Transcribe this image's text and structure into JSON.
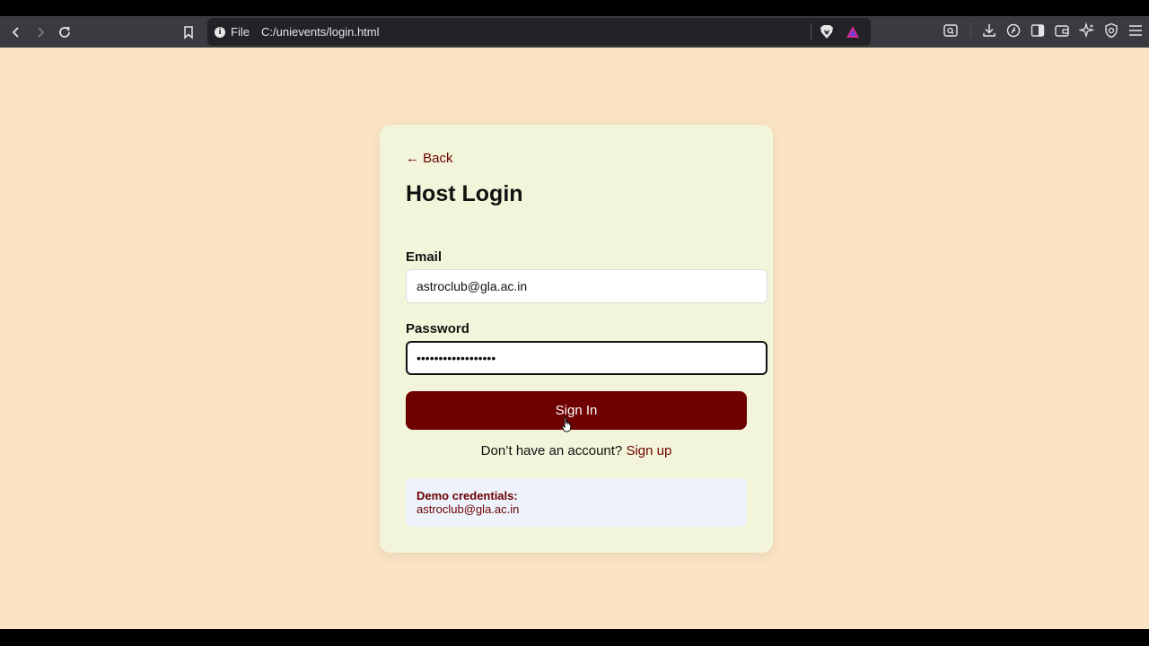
{
  "browser": {
    "url_scheme_label": "File",
    "url": "C:/unievents/login.html",
    "nav": {
      "back_icon": "chevron-left-icon",
      "forward_icon": "chevron-right-icon",
      "reload_icon": "reload-icon",
      "bookmark_icon": "bookmark-icon"
    },
    "toolbar_icons": [
      "search-tab-icon",
      "download-icon",
      "leo-icon",
      "sidebar-icon",
      "wallet-icon",
      "ai-sparkle-icon",
      "vpn-shield-icon",
      "menu-icon"
    ]
  },
  "colors": {
    "page_bg": "#fbe4c4",
    "card_bg": "#f3f5da",
    "accent": "#6e0000",
    "demo_bg": "#edf2fb"
  },
  "login": {
    "back_label": "← Back",
    "title": "Host Login",
    "email_label": "Email",
    "email_value": "astroclub@gla.ac.in",
    "password_label": "Password",
    "password_value": "••••••••••••••••••",
    "signin_label": "Sign In",
    "signup_prompt": "Don’t have an account?",
    "signup_link": "Sign up",
    "demo_title": "Demo credentials:",
    "demo_email": "astroclub@gla.ac.in"
  }
}
